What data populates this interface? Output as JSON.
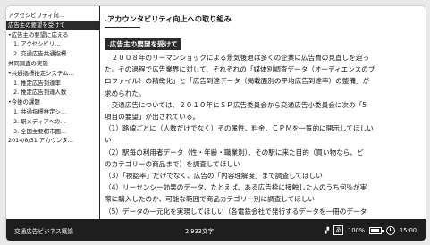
{
  "sidebar": {
    "items": [
      {
        "label": "アクセシビリティ向…",
        "level": 0,
        "active": false
      },
      {
        "label": "広告主の要望を受けて",
        "level": 0,
        "active": true
      },
      {
        "label": "•広告主の要望に応える",
        "level": 0,
        "active": false
      },
      {
        "label": "1. アクセシビリ…",
        "level": 1,
        "active": false
      },
      {
        "label": "2. 交通広告共通指標…",
        "level": 1,
        "active": false
      },
      {
        "label": "共同調査の実施",
        "level": 0,
        "active": false
      },
      {
        "label": "•共通指標推定システム…",
        "level": 0,
        "active": false
      },
      {
        "label": "1. 推定広告到達率",
        "level": 1,
        "active": false
      },
      {
        "label": "2. 推定広告到達人数",
        "level": 1,
        "active": false
      },
      {
        "label": "•今後の課題",
        "level": 0,
        "active": false
      },
      {
        "label": "1. 共通指標推定シ…",
        "level": 1,
        "active": false
      },
      {
        "label": "2. 駅メディアへの…",
        "level": 1,
        "active": false
      },
      {
        "label": "3. 全国主要都市圏…",
        "level": 1,
        "active": false
      },
      {
        "label": "2014/8/31 アカウンタ…",
        "level": 0,
        "active": false
      }
    ]
  },
  "document": {
    "title": ".アカウンタビリティ向上への取り組み",
    "section_heading": ".広告主の要望を受けて",
    "lines": [
      "　２００８年のリーマンショックによる景気後退は多くの企業に広告費の見直しを迫っ",
      "た。その過程で広告業界に対して、それぞれの「媒体別調査データ（オーディエンスのプ",
      "ロファイル）の精緻化」と「広告到達データ（掲載面別の平均広告到達率）の整備」が",
      "求められた。",
      "　交通広告については、２０１０年にＳＰ広告委員会から交通広告小委員会に次の「5",
      "項目の要望」が出されている。",
      "（1）路線ごとに（人数だけでなく）その属性、料金、ＣＰＭを一覧的に開示してほしい",
      "い",
      "（2）駅毎の利用者データ（性・年齢・職業別）、その駅に来た目的（買い物なら、ど",
      "のカテゴリーの商品まで）を調査してほしい",
      "（3）「視認率」だけでなく、広告の「内容理解度」まで調査してほしい",
      "（4）リーセンシー効果のデータ、たとえば、ある広告枠に接触した人のうち何％が実",
      "際に購入したのか、可能な範囲で商品カテゴリー別に調査してほしい",
      "（5）データの一元化を実現してほしい（各電鉄会社で発行するデータを一冊のデータ",
      "ブックとしてまとめるなど）"
    ]
  },
  "footer": {
    "book_title": "交通広告ビジネス概論",
    "char_count": "2,933文字",
    "ime_label": "あ",
    "battery": "100%",
    "time": "15:00",
    "icons": [
      "keyboard-icon",
      "battery-icon",
      "clock-icon"
    ]
  }
}
